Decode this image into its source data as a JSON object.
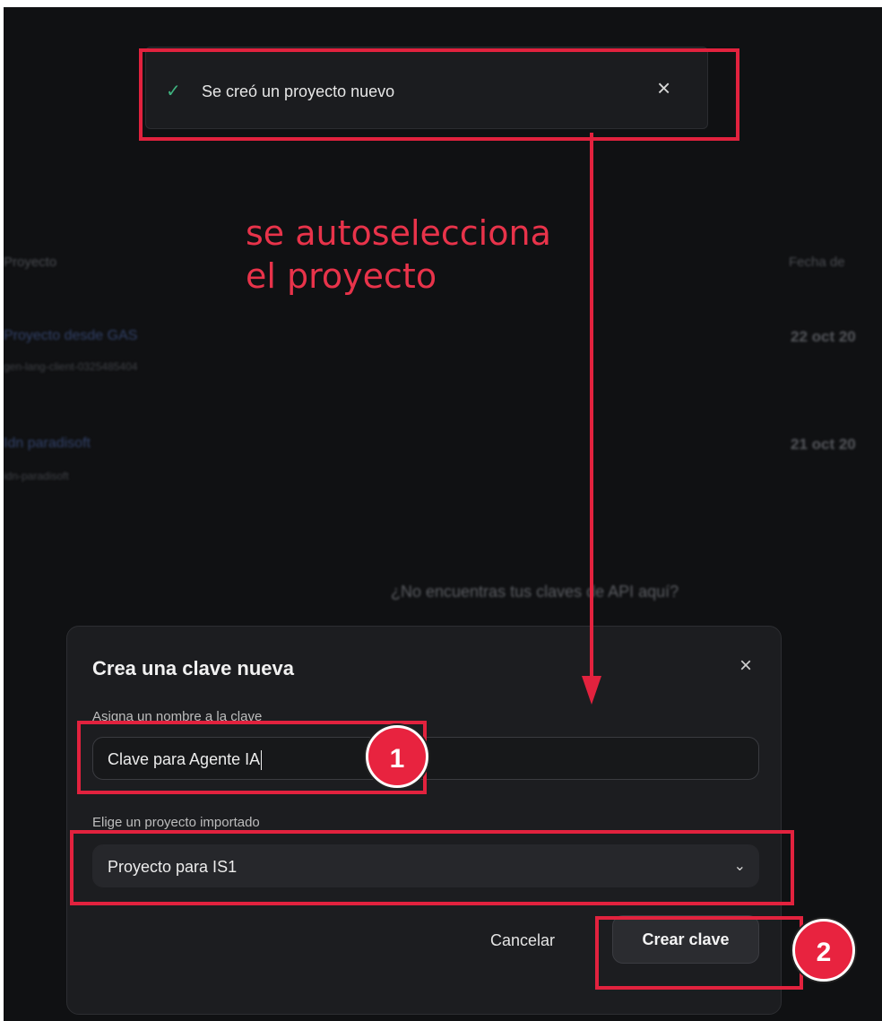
{
  "toast": {
    "message": "Se creó un proyecto nuevo"
  },
  "annotation": {
    "line1": "se autoselecciona",
    "line2": "el proyecto"
  },
  "background": {
    "col_project": "Proyecto",
    "col_date": "Fecha de",
    "rows": [
      {
        "name": "Proyecto desde GAS",
        "id": "gen-lang-client-0325485404",
        "date": "22 oct 20"
      },
      {
        "name": "Idn paradisoft",
        "id": "idn-paradisoft",
        "date": "21 oct 20"
      }
    ],
    "question": "¿No encuentras tus claves de API aquí?"
  },
  "dialog": {
    "title": "Crea una clave nueva",
    "name_label": "Asigna un nombre a la clave",
    "name_value": "Clave para Agente IA",
    "project_label": "Elige un proyecto importado",
    "project_value": "Proyecto para IS1",
    "cancel_label": "Cancelar",
    "create_label": "Crear clave"
  },
  "badges": {
    "one": "1",
    "two": "2"
  },
  "colors": {
    "accent_red": "#e2223e",
    "success_green": "#3fb27f"
  }
}
